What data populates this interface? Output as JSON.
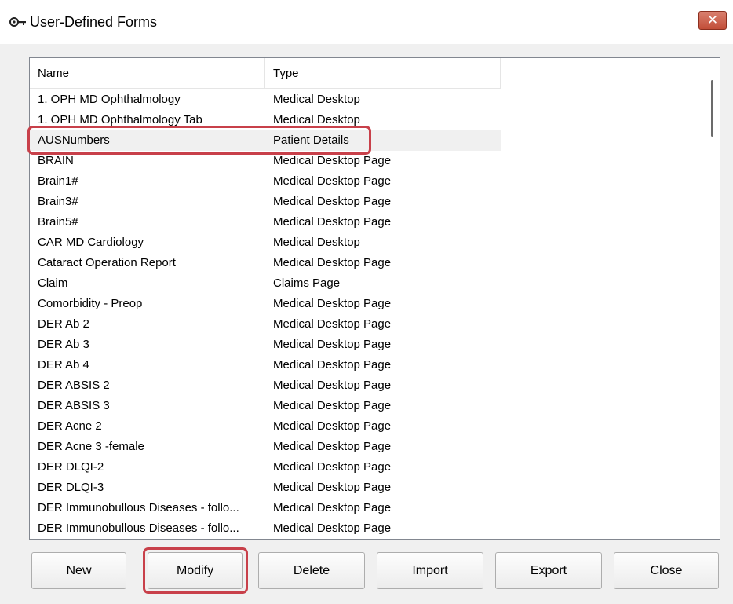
{
  "window": {
    "title": "User-Defined Forms",
    "close_label": "✕"
  },
  "list": {
    "columns": [
      "Name",
      "Type"
    ],
    "rows": [
      {
        "name": "1. OPH MD Ophthalmology",
        "type": "Medical Desktop"
      },
      {
        "name": "1. OPH MD Ophthalmology Tab",
        "type": "Medical Desktop"
      },
      {
        "name": "AUSNumbers",
        "type": "Patient Details",
        "selected": true
      },
      {
        "name": "BRAIN",
        "type": "Medical Desktop Page"
      },
      {
        "name": "Brain1#",
        "type": "Medical Desktop Page"
      },
      {
        "name": "Brain3#",
        "type": "Medical Desktop Page"
      },
      {
        "name": "Brain5#",
        "type": "Medical Desktop Page"
      },
      {
        "name": "CAR MD Cardiology",
        "type": "Medical Desktop"
      },
      {
        "name": "Cataract Operation Report",
        "type": "Medical Desktop Page"
      },
      {
        "name": "Claim",
        "type": "Claims Page"
      },
      {
        "name": "Comorbidity - Preop",
        "type": "Medical Desktop Page"
      },
      {
        "name": "DER Ab 2",
        "type": "Medical Desktop Page"
      },
      {
        "name": "DER Ab 3",
        "type": "Medical Desktop Page"
      },
      {
        "name": "DER Ab 4",
        "type": "Medical Desktop Page"
      },
      {
        "name": "DER ABSIS 2",
        "type": "Medical Desktop Page"
      },
      {
        "name": "DER ABSIS 3",
        "type": "Medical Desktop Page"
      },
      {
        "name": "DER Acne 2",
        "type": "Medical Desktop Page"
      },
      {
        "name": "DER Acne 3 -female",
        "type": "Medical Desktop Page"
      },
      {
        "name": "DER DLQI-2",
        "type": "Medical Desktop Page"
      },
      {
        "name": "DER DLQI-3",
        "type": "Medical Desktop Page"
      },
      {
        "name": "DER Immunobullous Diseases - follo...",
        "type": "Medical Desktop Page"
      },
      {
        "name": "DER Immunobullous Diseases - follo...",
        "type": "Medical Desktop Page"
      }
    ]
  },
  "buttons": {
    "new": "New",
    "modify": "Modify",
    "delete": "Delete",
    "import": "Import",
    "export": "Export",
    "close": "Close"
  },
  "colors": {
    "highlight": "#c8404a",
    "selected_row": "#f0f0f0",
    "close_button": "#c24e38"
  },
  "icons": {
    "title": "keys-icon",
    "close": "close-icon"
  }
}
